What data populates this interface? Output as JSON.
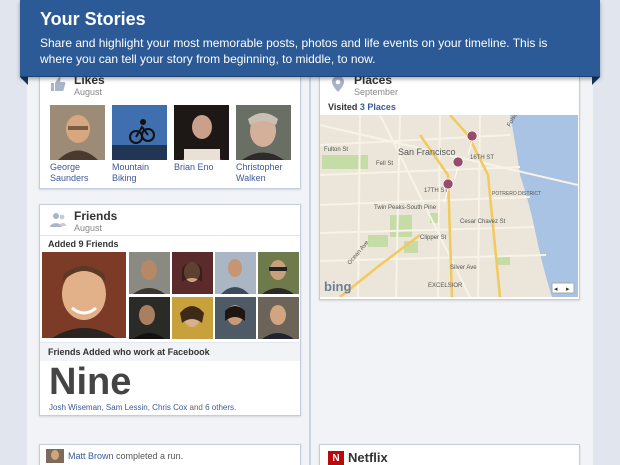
{
  "banner": {
    "title": "Your Stories",
    "description": "Share and highlight your most memorable posts, photos and life events on your timeline. This is where you can tell your story from beginning, to middle, to now."
  },
  "likes": {
    "title": "Likes",
    "subtitle": "August",
    "items": [
      {
        "label": "George Saunders",
        "color": "#8a6a4e"
      },
      {
        "label": "Mountain Biking",
        "color": "#4a77b5"
      },
      {
        "label": "Brian Eno",
        "color": "#3a2b25"
      },
      {
        "label": "Christopher Walken",
        "color": "#6e6a60"
      }
    ]
  },
  "friends": {
    "title": "Friends",
    "subtitle": "August",
    "added_label": "Added 9 Friends",
    "work_label": "Friends Added who work at Facebook",
    "count_word": "Nine",
    "names": [
      "Josh Wiseman",
      "Sam Lessin",
      "Chris Cox"
    ],
    "and_text": "and",
    "others_link": "6 others."
  },
  "places": {
    "title": "Places",
    "subtitle": "September",
    "visited_prefix": "Visited",
    "visited_link": "3 Places",
    "map_labels": {
      "city": "San Francisco",
      "st_16": "16TH ST",
      "st_17": "17TH ST",
      "fell": "Fell St",
      "fulton": "Fulton St",
      "folsom": "Folsom St",
      "potrero": "POTRERO DISTRICT",
      "cesar": "Cesar Chavez St",
      "twin_peaks": "Twin Peaks-South Pine",
      "clipper": "Clipper St",
      "silver": "Silver Ave",
      "excelsior": "EXCELSIOR",
      "ocean": "Ocean Ave",
      "bing": "bing"
    }
  },
  "activity": {
    "user": "Matt Brown",
    "action": "completed a run."
  },
  "netflix": {
    "title": "Netflix",
    "logo_letter": "N"
  },
  "colors": {
    "banner": "#2b5a96",
    "link": "#3b5998",
    "pin": "#9a4a6b"
  }
}
